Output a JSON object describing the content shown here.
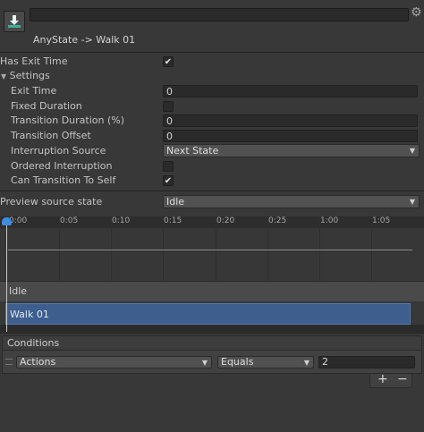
{
  "header": {
    "title": "AnyState -> Walk 01",
    "name_value": "",
    "icon": "transition-download-icon",
    "settings_icon": "gear-icon"
  },
  "props": {
    "has_exit_time": {
      "label": "Has Exit Time",
      "checked": "✔"
    },
    "settings_label": "Settings",
    "exit_time": {
      "label": "Exit Time",
      "value": "0"
    },
    "fixed_duration": {
      "label": "Fixed Duration",
      "checked": ""
    },
    "transition_duration": {
      "label": "Transition Duration (%)",
      "value": "0"
    },
    "transition_offset": {
      "label": "Transition Offset",
      "value": "0"
    },
    "interruption_source": {
      "label": "Interruption Source",
      "value": "Next State"
    },
    "ordered_interruption": {
      "label": "Ordered Interruption",
      "checked": ""
    },
    "can_transition_to_self": {
      "label": "Can Transition To Self",
      "checked": "✔"
    },
    "preview_source_state": {
      "label": "Preview source state",
      "value": "Idle"
    }
  },
  "timeline": {
    "ticks": [
      "0:00",
      "0:05",
      "0:10",
      "0:15",
      "0:20",
      "0:25",
      "1:00",
      "1:05"
    ],
    "source_state": "Idle",
    "dest_state": "Walk 01"
  },
  "conditions": {
    "header": "Conditions",
    "parameter": "Actions",
    "mode": "Equals",
    "value": "2",
    "add_label": "+",
    "remove_label": "−"
  }
}
